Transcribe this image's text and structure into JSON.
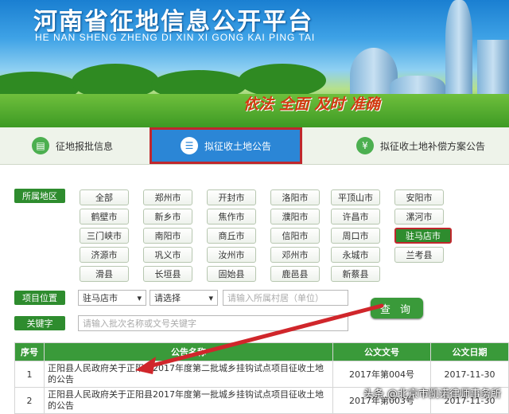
{
  "banner": {
    "title": "河南省征地信息公开平台",
    "subtitle": "HE NAN SHENG ZHENG DI XIN XI GONG KAI PING TAI",
    "slogan": "依法  全面  及时  准确"
  },
  "tabs": [
    {
      "label": "征地报批信息",
      "icon": "document-icon"
    },
    {
      "label": "拟征收土地公告",
      "icon": "list-icon"
    },
    {
      "label": "拟征收土地补偿方案公告",
      "icon": "money-icon"
    }
  ],
  "filters": {
    "region_label": "所属地区",
    "cities": [
      "全部",
      "郑州市",
      "开封市",
      "洛阳市",
      "平顶山市",
      "安阳市",
      "鹤壁市",
      "新乡市",
      "焦作市",
      "濮阳市",
      "许昌市",
      "漯河市",
      "三门峡市",
      "南阳市",
      "商丘市",
      "信阳市",
      "周口市",
      "驻马店市",
      "济源市",
      "巩义市",
      "汝州市",
      "邓州市",
      "永城市",
      "兰考县",
      "滑县",
      "长垣县",
      "固始县",
      "鹿邑县",
      "新蔡县"
    ],
    "selected_city": "驻马店市",
    "location_label": "项目位置",
    "location_select1": "驻马店市",
    "location_select2": "请选择",
    "village_placeholder": "请输入所属村居（单位）",
    "keyword_label": "关键字",
    "keyword_placeholder": "请输入批次名称或文号关键字",
    "search_button": "查 询"
  },
  "table": {
    "headers": [
      "序号",
      "公告名称",
      "公文文号",
      "公文日期"
    ],
    "rows": [
      {
        "no": "1",
        "name": "正阳县人民政府关于正阳县2017年度第二批城乡挂钩试点项目征收土地的公告",
        "doc": "2017年第004号",
        "date": "2017-11-30"
      },
      {
        "no": "2",
        "name": "正阳县人民政府关于正阳县2017年度第一批城乡挂钩试点项目征收土地的公告",
        "doc": "2017年第003号",
        "date": "2017-11-30"
      }
    ]
  },
  "watermark": "头条 @北京市凯诺律师事务所",
  "colors": {
    "accent_green": "#2e8c2e",
    "highlight_red": "#c0272d",
    "tab_blue": "#2b86d6"
  }
}
